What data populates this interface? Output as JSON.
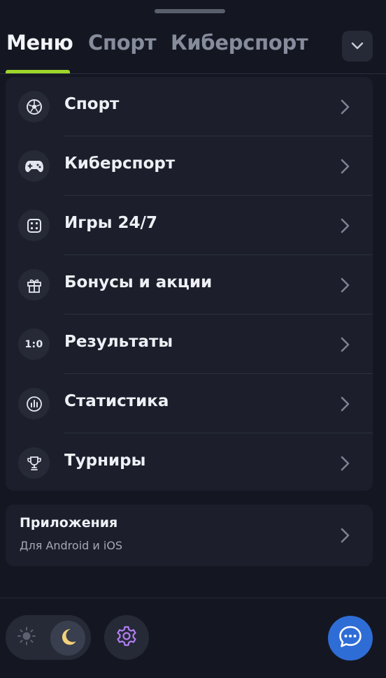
{
  "tabs": [
    {
      "label": "Меню",
      "active": true
    },
    {
      "label": "Спорт",
      "active": false
    },
    {
      "label": "Киберспорт",
      "active": false
    }
  ],
  "dropdown_icon": "chevron-down-icon",
  "menu": {
    "items": [
      {
        "label": "Спорт",
        "icon": "soccer-ball-icon"
      },
      {
        "label": "Киберспорт",
        "icon": "gamepad-icon"
      },
      {
        "label": "Игры 24/7",
        "icon": "dice-icon"
      },
      {
        "label": "Бонусы и акции",
        "icon": "gift-icon"
      },
      {
        "label": "Результаты",
        "icon": "score-icon",
        "icon_text": "1:0"
      },
      {
        "label": "Статистика",
        "icon": "statistics-icon"
      },
      {
        "label": "Турниры",
        "icon": "trophy-icon"
      }
    ]
  },
  "apps": {
    "title": "Приложения",
    "subtitle": "Для Android и iOS"
  },
  "footer": {
    "theme": "dark",
    "sun_icon": "sun-icon",
    "moon_icon": "moon-icon",
    "settings_icon": "gear-icon",
    "chat_icon": "chat-icon"
  },
  "colors": {
    "background": "#141722",
    "card": "#1c1f2b",
    "accent": "#9ed52b",
    "chat_button": "#2f6dd6",
    "settings_icon": "#b07ef0",
    "moon": "#f3d17a"
  }
}
